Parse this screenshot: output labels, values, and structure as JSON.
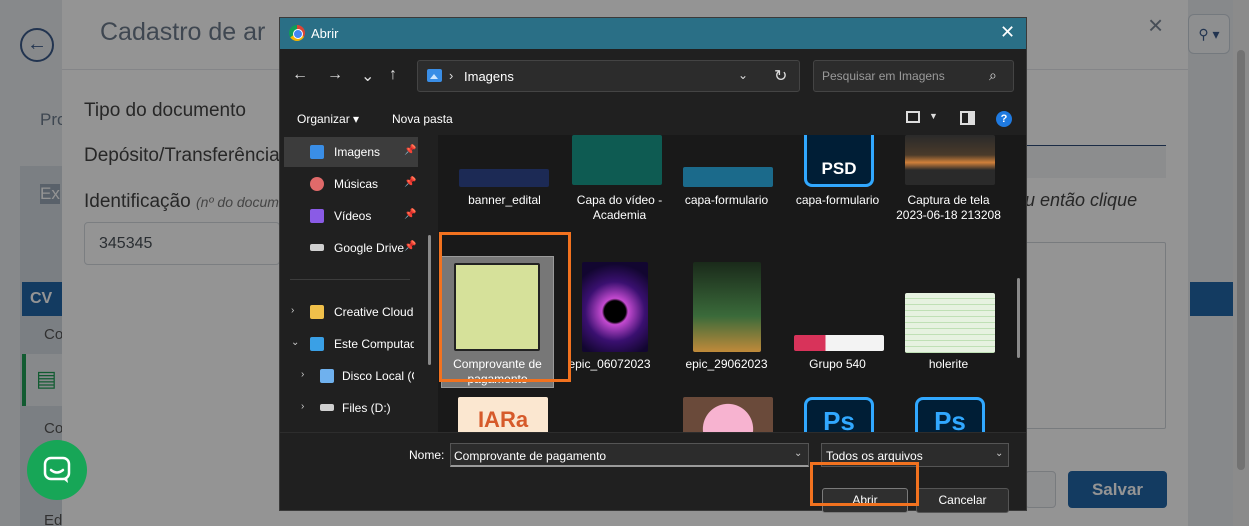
{
  "background": {
    "modal_title": "Cadastro de ar",
    "tab_partial": "Pro",
    "left_card_partial": "Ex",
    "cv_label": "CV",
    "co_label_1": "Co",
    "co_label_2": "Co",
    "ed_label": "Ed",
    "tipo_label": "Tipo do documento",
    "deposito_label": "Depósito/Transferência",
    "identificacao_label": "Identificação",
    "identificacao_hint": "(nº do docum",
    "identificacao_value": "345345",
    "right_hint": "u então clique",
    "save_button": "Salvar",
    "close_icon": "×",
    "back_icon": "←",
    "user_menu_icon": "user-dropdown-icon"
  },
  "dialog": {
    "title": "Abrir",
    "close": "✕",
    "nav": {
      "back": "←",
      "forward": "→",
      "recent": "⌄",
      "up": "↑",
      "path_separator": "›",
      "path": "Imagens",
      "refresh": "↻"
    },
    "search": {
      "placeholder": "Pesquisar em Imagens",
      "icon": "⌕"
    },
    "commands": {
      "organize": "Organizar ▾",
      "new_folder": "Nova pasta",
      "help": "?"
    },
    "sidebar": [
      {
        "label": "Imagens",
        "icon": "image-folder-icon",
        "color": "#3a8ee6",
        "pinned": true,
        "active": true
      },
      {
        "label": "Músicas",
        "icon": "music-folder-icon",
        "color": "#e06a6a",
        "pinned": true
      },
      {
        "label": "Vídeos",
        "icon": "video-folder-icon",
        "color": "#8a5be6",
        "pinned": true
      },
      {
        "label": "Google Drive",
        "icon": "drive-icon",
        "color": "#cfcfcf",
        "pinned": true
      },
      {
        "label": "Creative Cloud F",
        "icon": "creative-cloud-folder-icon",
        "color": "#f0c04a",
        "expandable": true
      },
      {
        "label": "Este Computador",
        "icon": "computer-icon",
        "color": "#3aa0e6",
        "expanded": true
      },
      {
        "label": "Disco Local (C",
        "icon": "local-disk-icon",
        "color": "#6fb1ee",
        "expandable": true
      },
      {
        "label": "Files (D:)",
        "icon": "drive-icon",
        "color": "#cfcfcf",
        "expandable": true
      }
    ],
    "files": [
      {
        "name": "banner_edital",
        "thumb": "#1a1f3a"
      },
      {
        "name": "Capa do vídeo - Academia",
        "thumb": "#0e5b52"
      },
      {
        "name": "capa-formulario",
        "thumb": "#1b4a6b"
      },
      {
        "name": "capa-formulario",
        "thumb": "#1d3d74",
        "badge": "PSD"
      },
      {
        "name": "Captura de tela 2023-06-18 213208",
        "thumb": "#3a3a3a"
      },
      {
        "name": "Comprovante de pagamento",
        "thumb": "#d6e19a",
        "selected": true
      },
      {
        "name": "epic_06072023",
        "thumb": "#1a0c3a"
      },
      {
        "name": "epic_29062023",
        "thumb": "#3a2a1a"
      },
      {
        "name": "Grupo 540",
        "thumb": "#d8335a"
      },
      {
        "name": "holerite",
        "thumb": "#e6f2e0"
      },
      {
        "name": "",
        "thumb": "#fbe7d0",
        "logo": "IARa"
      },
      {
        "name": "",
        "thumb": "#f2a6c8"
      },
      {
        "name": "",
        "thumb": "#1d3d74",
        "badge": "Ps"
      },
      {
        "name": "",
        "thumb": "#1d3d74",
        "badge": "Ps"
      }
    ],
    "bottom": {
      "name_label": "Nome:",
      "name_value": "Comprovante de pagamento",
      "type_value": "Todos os arquivos",
      "open_button": "Abrir",
      "cancel_button": "Cancelar"
    }
  },
  "colors": {
    "highlight": "#f2721f",
    "save_blue": "#2166a7",
    "chat_green": "#17a657"
  }
}
